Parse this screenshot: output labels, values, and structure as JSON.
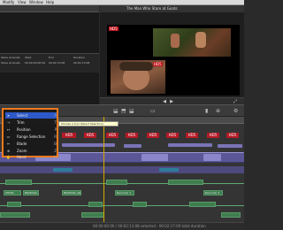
{
  "menubar": {
    "items": [
      "Modify",
      "View",
      "Window",
      "Help"
    ]
  },
  "viewer": {
    "title": "The Man Who Stare at Goats",
    "badges": [
      {
        "text": "HD5"
      },
      {
        "text": "HD5"
      }
    ]
  },
  "browser": {
    "columns": [
      "Stare at Goats",
      "Start",
      "End",
      "Duration"
    ],
    "row": [
      "Stare at Goats",
      "00:00:00:00:00",
      "00:02:13:08",
      "00:02:13:08"
    ]
  },
  "tool_menu": {
    "items": [
      {
        "icon": "arrow",
        "label": "Select",
        "key": "A",
        "selected": true
      },
      {
        "icon": "trim",
        "label": "Trim",
        "key": "T",
        "selected": false
      },
      {
        "icon": "position",
        "label": "Position",
        "key": "P",
        "selected": false
      },
      {
        "icon": "range",
        "label": "Range Selection",
        "key": "R",
        "selected": false
      },
      {
        "icon": "blade",
        "label": "Blade",
        "key": "B",
        "selected": false
      },
      {
        "icon": "zoom",
        "label": "Zoom",
        "key": "Z",
        "selected": false
      },
      {
        "icon": "hand",
        "label": "Hand",
        "key": "H",
        "selected": false
      }
    ],
    "tooltip": "Choose a tool (Select Selection)"
  },
  "timeline": {
    "title_clips": [
      "HD5",
      "HD5",
      "HD5",
      "HD5",
      "HD5",
      "HD5",
      "HD5",
      "HD5",
      "HD5"
    ],
    "audio_clips": [
      "SHOW",
      "BGMUSIC_WAV",
      "BGMUSIC_WAV",
      "Recorder 1",
      "Recorder 2"
    ],
    "footer": "00:00:00:00 / 00:02:13:08 selected - 00:02:17:00 total duration"
  },
  "colors": {
    "accent_red": "#c0121b",
    "highlight_orange": "#f07a1d",
    "selection_blue": "#2d59c9",
    "clip_green": "#3f7d4f",
    "clip_purple": "#7a74b8",
    "playhead": "#d5a900"
  }
}
